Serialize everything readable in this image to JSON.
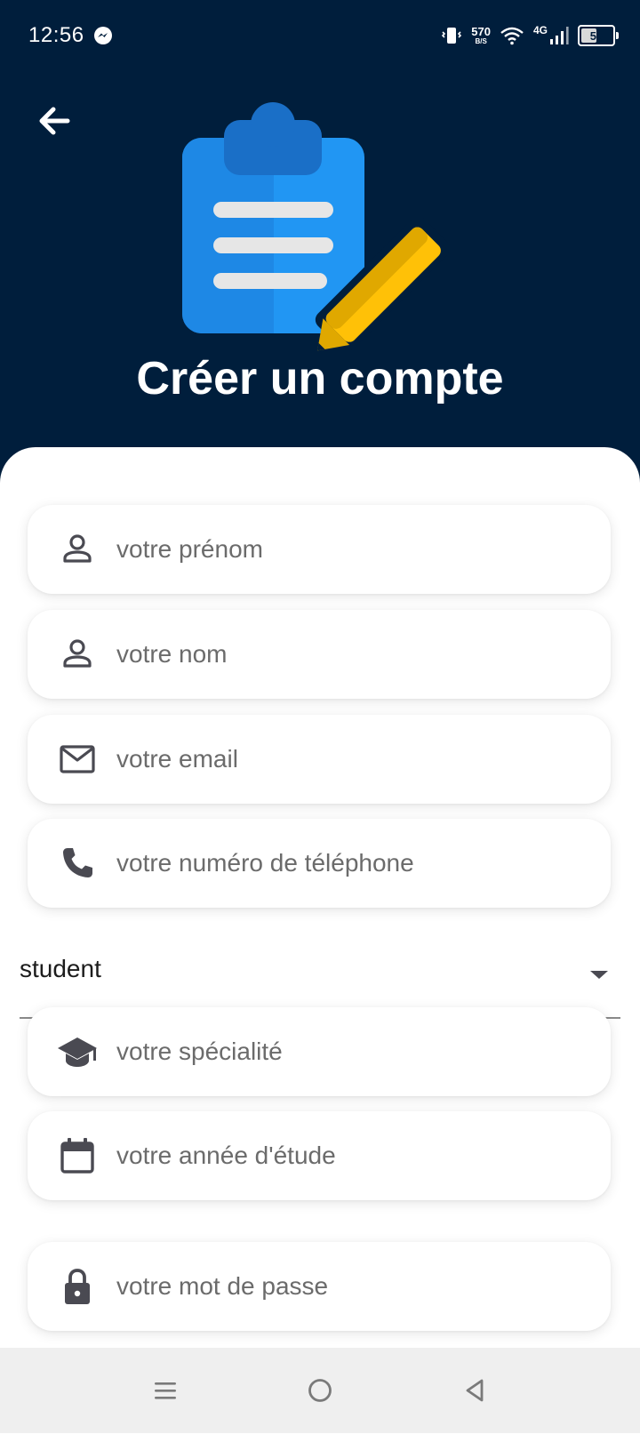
{
  "status_bar": {
    "time": "12:56",
    "net_speed": "570",
    "net_unit": "B/S",
    "network_type": "4G",
    "battery_level": "56",
    "battery_fraction": 0.56
  },
  "header": {
    "title": "Créer un compte",
    "background_color": "#001e3c"
  },
  "form": {
    "first_name": {
      "placeholder": "votre prénom",
      "icon": "person-icon"
    },
    "last_name": {
      "placeholder": "votre nom",
      "icon": "person-icon"
    },
    "email": {
      "placeholder": "votre email",
      "icon": "mail-icon"
    },
    "phone": {
      "placeholder": "votre numéro de téléphone",
      "icon": "phone-icon"
    },
    "role_select": {
      "value": "student",
      "icon": "dropdown-arrow-icon"
    },
    "speciality": {
      "placeholder": "votre spécialité",
      "icon": "graduation-cap-icon"
    },
    "study_year": {
      "placeholder": "votre année d'étude",
      "icon": "calendar-icon"
    },
    "password": {
      "placeholder": "votre mot de passe",
      "icon": "lock-icon"
    }
  },
  "nav_bar": {
    "icons": [
      "menu-icon",
      "home-circle-icon",
      "back-triangle-icon"
    ]
  },
  "colors": {
    "accent_blue": "#2196f3",
    "dark_blue": "#1976d2",
    "pencil_yellow": "#ffc107",
    "icon_gray": "#4a4a52"
  }
}
